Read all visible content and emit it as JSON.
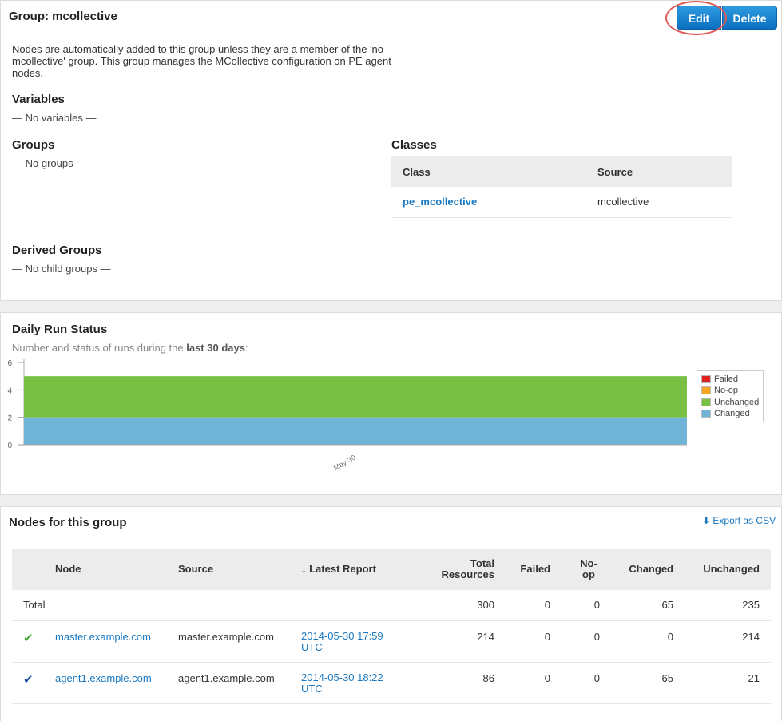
{
  "group": {
    "title": "Group: mcollective",
    "edit_label": "Edit",
    "delete_label": "Delete",
    "description": "Nodes are automatically added to this group unless they are a member of the 'no mcollective' group. This group manages the MCollective configuration on PE agent nodes.",
    "variables_heading": "Variables",
    "variables_empty": "— No variables —",
    "groups_heading": "Groups",
    "groups_empty": "— No groups —",
    "classes_heading": "Classes",
    "classes_headers": [
      "Class",
      "Source"
    ],
    "classes_rows": [
      {
        "class": "pe_mcollective",
        "source": "mcollective"
      }
    ],
    "derived_heading": "Derived Groups",
    "derived_empty": "— No child groups —"
  },
  "run_status": {
    "heading": "Daily Run Status",
    "subtitle_prefix": "Number and status of runs during the ",
    "subtitle_bold": "last 30 days",
    "subtitle_suffix": ":",
    "legend": [
      {
        "label": "Failed",
        "color": "#dd2222"
      },
      {
        "label": "No-op",
        "color": "#f5a623"
      },
      {
        "label": "Unchanged",
        "color": "#78c043"
      },
      {
        "label": "Changed",
        "color": "#6fb3d8"
      }
    ]
  },
  "chart_data": {
    "type": "area",
    "x": [
      "May-30"
    ],
    "ylim": [
      0,
      6
    ],
    "yticks": [
      0,
      2,
      4,
      6
    ],
    "stacked": true,
    "series": [
      {
        "name": "Changed",
        "values": [
          2
        ],
        "color": "#6fb3d8"
      },
      {
        "name": "Unchanged",
        "values": [
          3
        ],
        "color": "#78c043"
      },
      {
        "name": "No-op",
        "values": [
          0
        ],
        "color": "#f5a623"
      },
      {
        "name": "Failed",
        "values": [
          0
        ],
        "color": "#dd2222"
      }
    ],
    "legend_position": "right"
  },
  "nodes": {
    "heading": "Nodes for this group",
    "export_label": "Export as CSV",
    "headers": {
      "node": "Node",
      "source": "Source",
      "latest": "↓ Latest Report",
      "total": "Total Resources",
      "failed": "Failed",
      "noop": "No-op",
      "changed": "Changed",
      "unchanged": "Unchanged"
    },
    "total_row": {
      "label": "Total",
      "total": "300",
      "failed": "0",
      "noop": "0",
      "changed": "65",
      "unchanged": "235"
    },
    "rows": [
      {
        "status_icon": "check-green-icon",
        "node": "master.example.com",
        "source": "master.example.com",
        "latest": "2014-05-30 17:59 UTC",
        "total": "214",
        "failed": "0",
        "noop": "0",
        "changed": "0",
        "unchanged": "214"
      },
      {
        "status_icon": "check-blue-icon",
        "node": "agent1.example.com",
        "source": "agent1.example.com",
        "latest": "2014-05-30 18:22 UTC",
        "total": "86",
        "failed": "0",
        "noop": "0",
        "changed": "65",
        "unchanged": "21"
      }
    ]
  }
}
